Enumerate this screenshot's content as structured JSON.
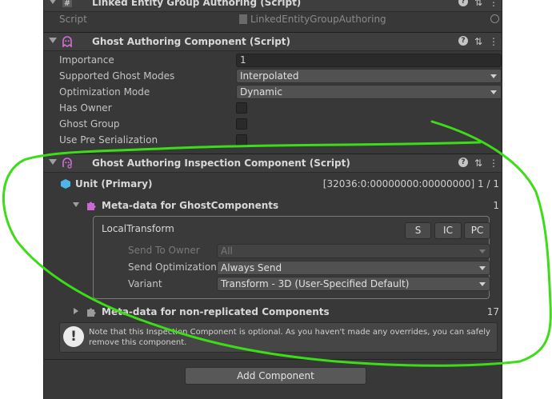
{
  "linked_entity": {
    "title": "Linked Entity Group Authoring (Script)",
    "script_label": "Script",
    "script_value": "LinkedEntityGroupAuthoring"
  },
  "ghost_authoring": {
    "title": "Ghost Authoring Component (Script)",
    "fields": {
      "importance_label": "Importance",
      "importance_value": "1",
      "supported_modes_label": "Supported Ghost Modes",
      "supported_modes_value": "Interpolated",
      "optimization_label": "Optimization Mode",
      "optimization_value": "Dynamic",
      "has_owner_label": "Has Owner",
      "ghost_group_label": "Ghost Group",
      "pre_serialization_label": "Use Pre Serialization"
    }
  },
  "inspection": {
    "title": "Ghost Authoring Inspection Component (Script)",
    "unit_label": "Unit (Primary)",
    "unit_id": "[32036:0:00000000:00000000] 1 / 1",
    "meta_ghost_label": "Meta-data for GhostComponents",
    "meta_ghost_count": "1",
    "local_transform": {
      "title": "LocalTransform",
      "buttons": [
        "S",
        "IC",
        "PC"
      ],
      "send_to_owner_label": "Send To Owner",
      "send_to_owner_value": "All",
      "send_optimization_label": "Send Optimization",
      "send_optimization_value": "Always Send",
      "variant_label": "Variant",
      "variant_value": "Transform - 3D (User-Specified Default)"
    },
    "meta_nonrep_label": "Meta-data for non-replicated Components",
    "meta_nonrep_count": "17",
    "help_text": "Note that this Inspection Component is optional. As you haven't made any overrides, you can safely remove this component."
  },
  "add_component_label": "Add Component",
  "colors": {
    "annotation": "#3ddc18",
    "panel_bg": "#383838",
    "header_bg": "#3e3e3e"
  }
}
